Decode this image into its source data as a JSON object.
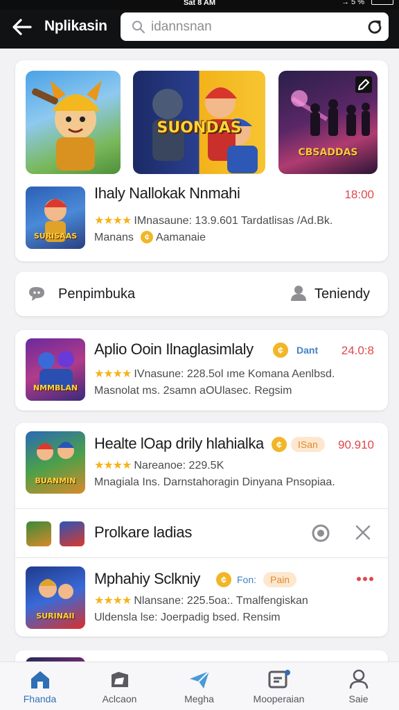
{
  "status_bar": {
    "time": "Sat 8 AM",
    "signal": "→ 5 %"
  },
  "header": {
    "title": "Nplikasin",
    "back_icon": "arrow-left-icon"
  },
  "search": {
    "placeholder": "idannsnan",
    "icon": "search-icon",
    "refresh_icon": "refresh-icon"
  },
  "banners": [
    {
      "title": "",
      "colors": [
        "#3d8fd6",
        "#8cc063"
      ]
    },
    {
      "title": "SUONDAS",
      "colors": [
        "#1b2a66",
        "#f3b21a"
      ]
    },
    {
      "title": "CBSADDAS",
      "colors": [
        "#1a1530",
        "#a1336b"
      ],
      "badge_icon": "edit-icon"
    }
  ],
  "featured": {
    "title": "Ihaly Nallokak Nnmahi",
    "price": "18:00",
    "stars": "★★★★",
    "stats": "IMnasaune: 13.9.601 Tardatlisas /Ad.Bk.",
    "sub_prefix": "Manans",
    "sub_suffix": "Aamanaie",
    "thumb_title": "SURISAAS"
  },
  "filter": {
    "left_label": "Penpimbuka",
    "left_icon": "chat-icon",
    "right_label": "Teniendy",
    "right_icon": "user-icon"
  },
  "games": [
    {
      "title": "Aplio Ooin Ilnaglasimlaly",
      "tag": "Dant",
      "price": "24.0:8",
      "stars": "★★★★",
      "stats": "IVnasune: 228.5ol   ıme Komana Aenlbsd.",
      "sub": "Masnolat ms. 2samn aOUlasec. Regsim",
      "thumb_title": "NMMBLAN"
    },
    {
      "title": "Healte lOap drily hlahialka",
      "tag": "ISan",
      "price": "90.910",
      "stars": "★★★★",
      "stats": "Nareanoe: 229.5K",
      "sub": "Mnagiala Ins. Darnstahoragin Dinyana Pnsopiaa.",
      "thumb_title": "BUANMIN"
    },
    {
      "title": "Mphahiy Sclkniy",
      "tag_plain": "Fon:",
      "tag": "Pain",
      "stars": "★★★★",
      "stats": "Nlansane: 225.5oa:.  Tmalfengiskan",
      "sub": "Uldensla lse: Joerpadig bsed. Rensim",
      "thumb_title": "SURINAII"
    }
  ],
  "promo": {
    "label": "Prolkare ladias",
    "target_icon": "target-icon",
    "close_icon": "close-icon"
  },
  "bottom_nav": [
    {
      "label": "Fhanda",
      "icon": "home-icon",
      "active": true
    },
    {
      "label": "Aclcaon",
      "icon": "folder-icon"
    },
    {
      "label": "Megha",
      "icon": "send-icon"
    },
    {
      "label": "Mooperaian",
      "icon": "message-icon"
    },
    {
      "label": "Saie",
      "icon": "profile-icon"
    }
  ],
  "colors": {
    "accent": "#2f6fb5",
    "price": "#e0474c",
    "star": "#f5b31a",
    "header_bg": "#111214"
  }
}
